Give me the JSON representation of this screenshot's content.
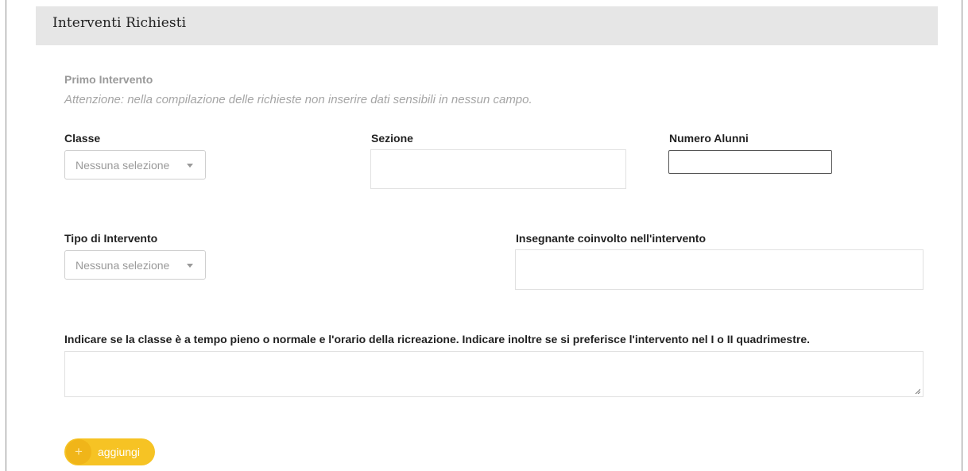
{
  "panel": {
    "title": "Interventi Richiesti"
  },
  "section": {
    "title": "Primo Intervento",
    "warning": "Attenzione: nella compilazione delle richieste non inserire dati sensibili in nessun campo."
  },
  "fields": {
    "classe": {
      "label": "Classe",
      "value": "Nessuna selezione"
    },
    "sezione": {
      "label": "Sezione",
      "value": ""
    },
    "numero_alunni": {
      "label": "Numero Alunni",
      "value": ""
    },
    "tipo_intervento": {
      "label": "Tipo di Intervento",
      "value": "Nessuna selezione"
    },
    "insegnante": {
      "label": "Insegnante coinvolto nell'intervento",
      "value": ""
    },
    "note": {
      "label": "Indicare se la classe è a tempo pieno o normale e l'orario della ricreazione. Indicare inoltre se si preferisce l'intervento nel I o II quadrimestre.",
      "value": ""
    }
  },
  "buttons": {
    "add_label": "aggiungi",
    "add_icon": "plus-icon"
  },
  "colors": {
    "accent": "#f6c324",
    "header_bg": "#e6e6e6"
  }
}
